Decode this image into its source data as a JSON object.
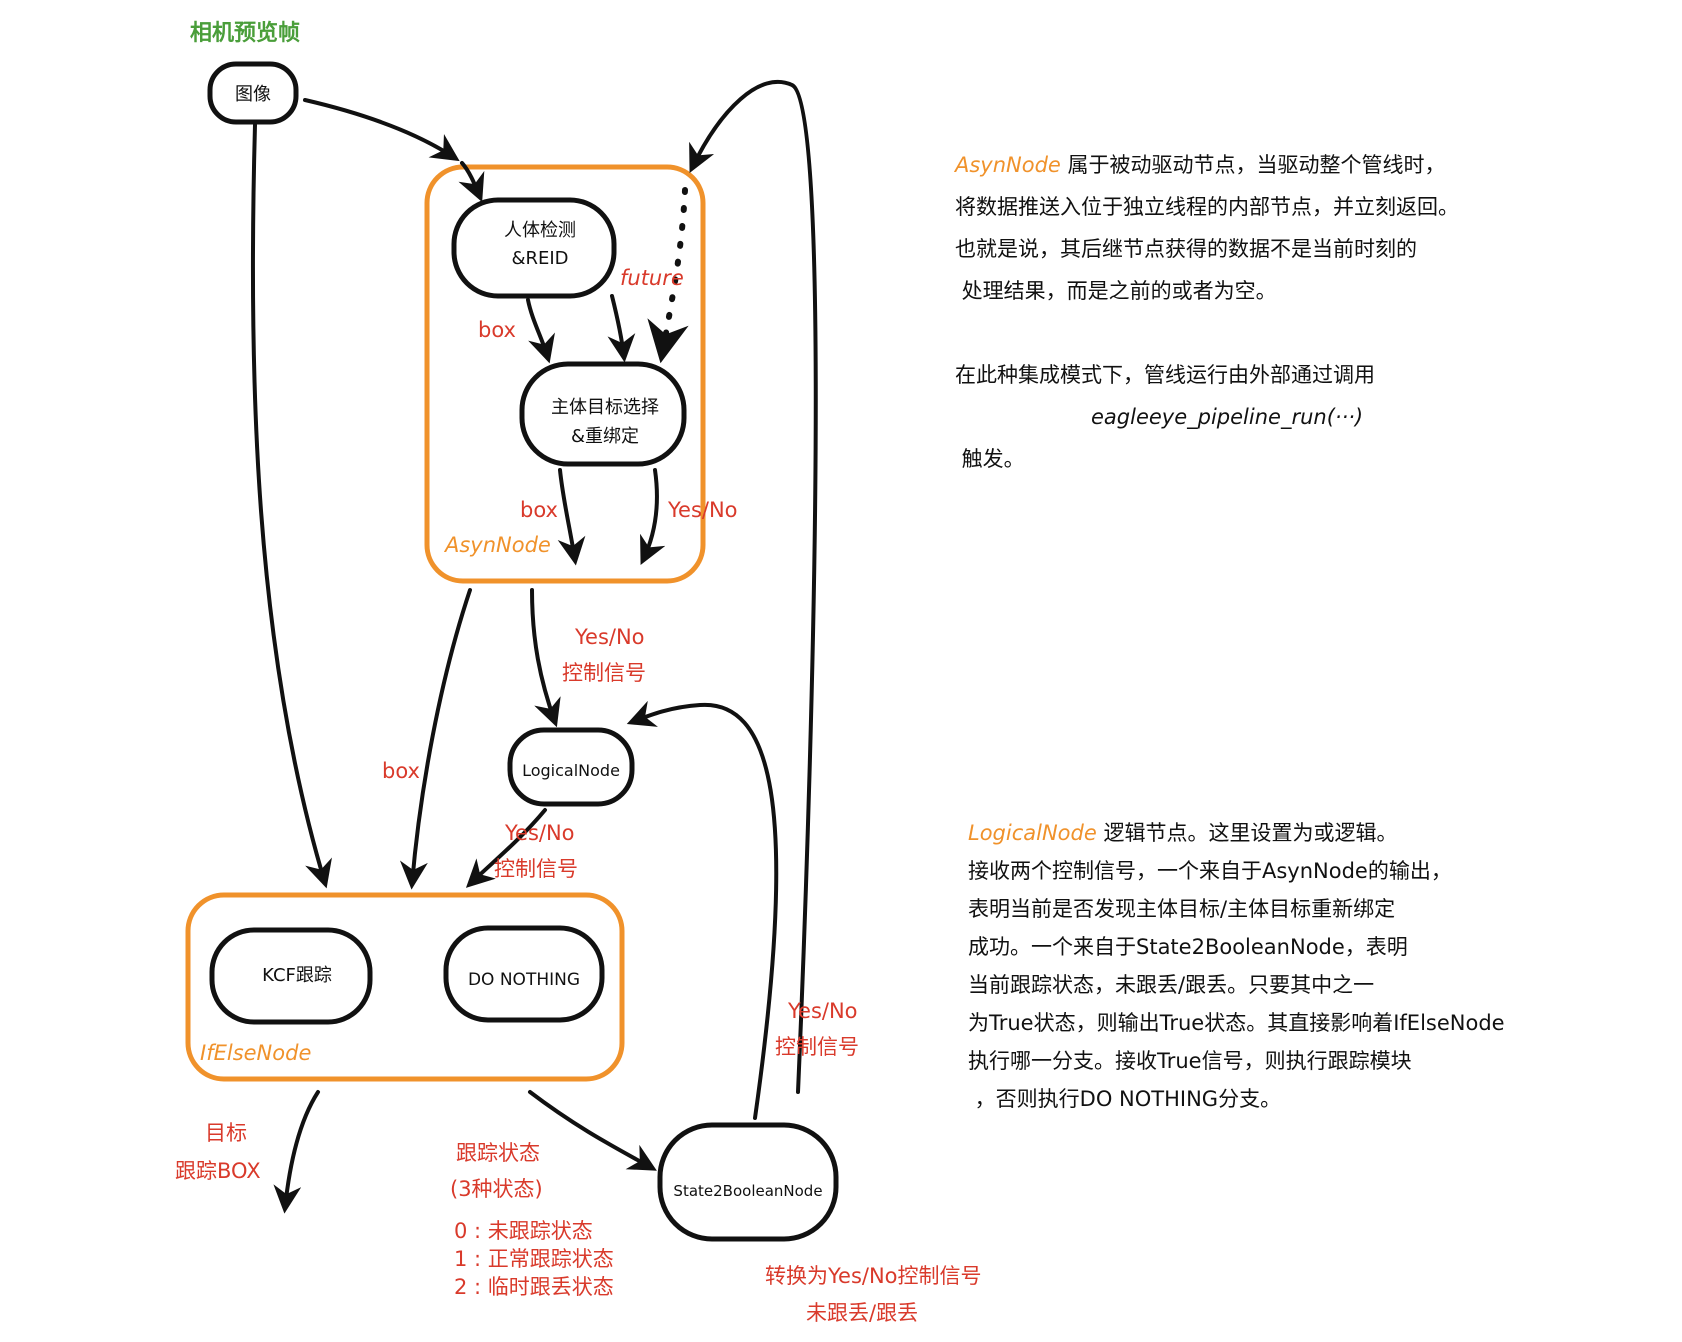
{
  "title": "相机预览帧",
  "colors": {
    "ink": "#111111",
    "red": "#d93a2b",
    "orange": "#f0922b",
    "green": "#4a9e3a"
  },
  "nodes": {
    "image": "图像",
    "detect_line1": "人体检测",
    "detect_line2": "&REID",
    "select_line1": "主体目标选择",
    "select_line2": "&重绑定",
    "logical": "LogicalNode",
    "kcf": "KCF跟踪",
    "donothing": "DO NOTHING",
    "state2bool": "State2BooleanNode"
  },
  "groups": {
    "asyn": "AsynNode",
    "ifelse": "IfElseNode"
  },
  "labels": {
    "future": "future",
    "box_detect": "box",
    "box_select": "box",
    "yesno_select": "Yes/No",
    "yesno_ctrl_line1": "Yes/No",
    "yesno_ctrl_line2": "控制信号",
    "box_left": "box",
    "yesno_logical_line1": "Yes/No",
    "yesno_logical_line2": "控制信号",
    "yesno_state_line1": "Yes/No",
    "yesno_state_line2": "控制信号",
    "target_line1": "目标",
    "target_line2": "跟踪BOX",
    "track_line1": "跟踪状态",
    "track_line2": "(3种状态)",
    "state0": "0 : 未跟踪状态",
    "state1": "1 : 正常跟踪状态",
    "state2": "2 : 临时跟丢状态",
    "convert_line1": "转换为Yes/No控制信号",
    "convert_line2": "未跟丢/跟丢"
  },
  "notes": {
    "asyn": {
      "keyword": "AsynNode",
      "line1": " 属于被动驱动节点，当驱动整个管线时，",
      "line2": "将数据推送入位于独立线程的内部节点，并立刻返回。",
      "line3": "也就是说，其后继节点获得的数据不是当前时刻的",
      "line4": " 处理结果，而是之前的或者为空。",
      "line5": "在此种集成模式下，管线运行由外部通过调用",
      "code": "eagleeye_pipeline_run(···)",
      "line6": " 触发。"
    },
    "logical": {
      "keyword": "LogicalNode",
      "line1": " 逻辑节点。这里设置为或逻辑。",
      "line2": "接收两个控制信号，一个来自于AsynNode的输出，",
      "line3": "表明当前是否发现主体目标/主体目标重新绑定",
      "line4": "成功。一个来自于State2BooleanNode，表明",
      "line5": "当前跟踪状态，未跟丢/跟丢。只要其中之一",
      "line6": "为True状态，则输出True状态。其直接影响着IfElseNode",
      "line7": "执行哪一分支。接收True信号，则执行跟踪模块",
      "line8": " ，否则执行DO NOTHING分支。"
    }
  }
}
